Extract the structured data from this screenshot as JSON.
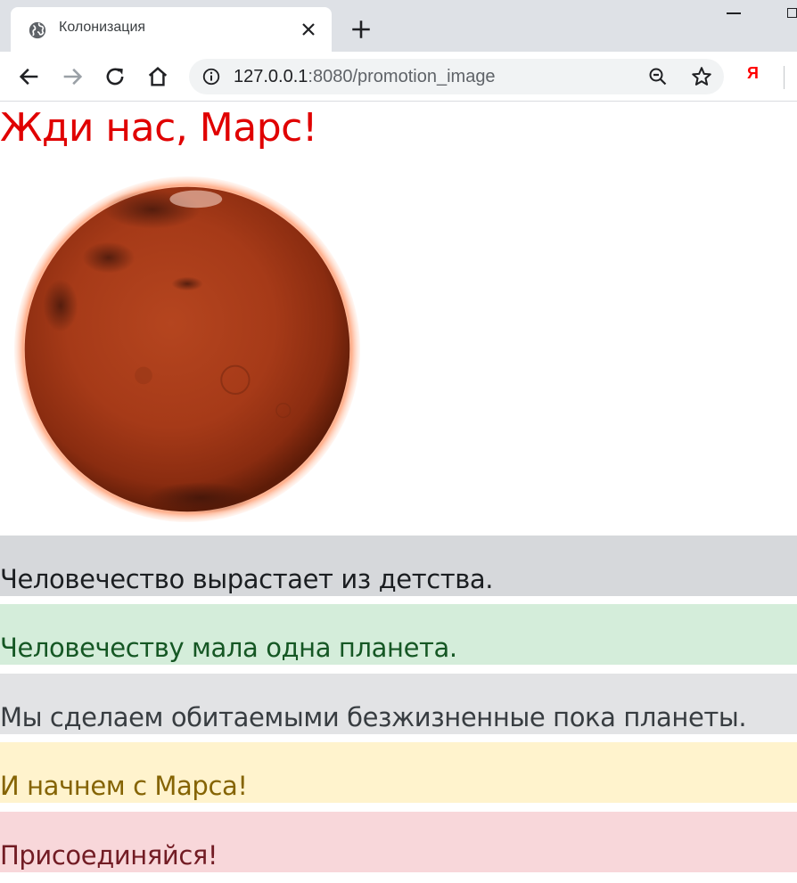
{
  "browser": {
    "tab": {
      "title": "Колонизация"
    },
    "address": {
      "host": "127.0.0.1",
      "port_and_path": ":8080/promotion_image"
    },
    "extension_label": "Я"
  },
  "page": {
    "title": "Жди нас, Марс!",
    "image": {
      "description_name": "mars-image"
    },
    "alerts": [
      {
        "text": "Человечество вырастает из детства."
      },
      {
        "text": "Человечеству мала одна планета."
      },
      {
        "text": "Мы сделаем обитаемыми безжизненные пока планеты."
      },
      {
        "text": "И начнем с Марса!"
      },
      {
        "text": "Присоединяйся!"
      }
    ]
  },
  "colors": {
    "title": "#e00000",
    "alert_dark_bg": "#d6d8db",
    "alert_success_bg": "#d4edda",
    "alert_secondary_bg": "#e2e3e5",
    "alert_warning_bg": "#fff3cd",
    "alert_danger_bg": "#f8d7da"
  }
}
